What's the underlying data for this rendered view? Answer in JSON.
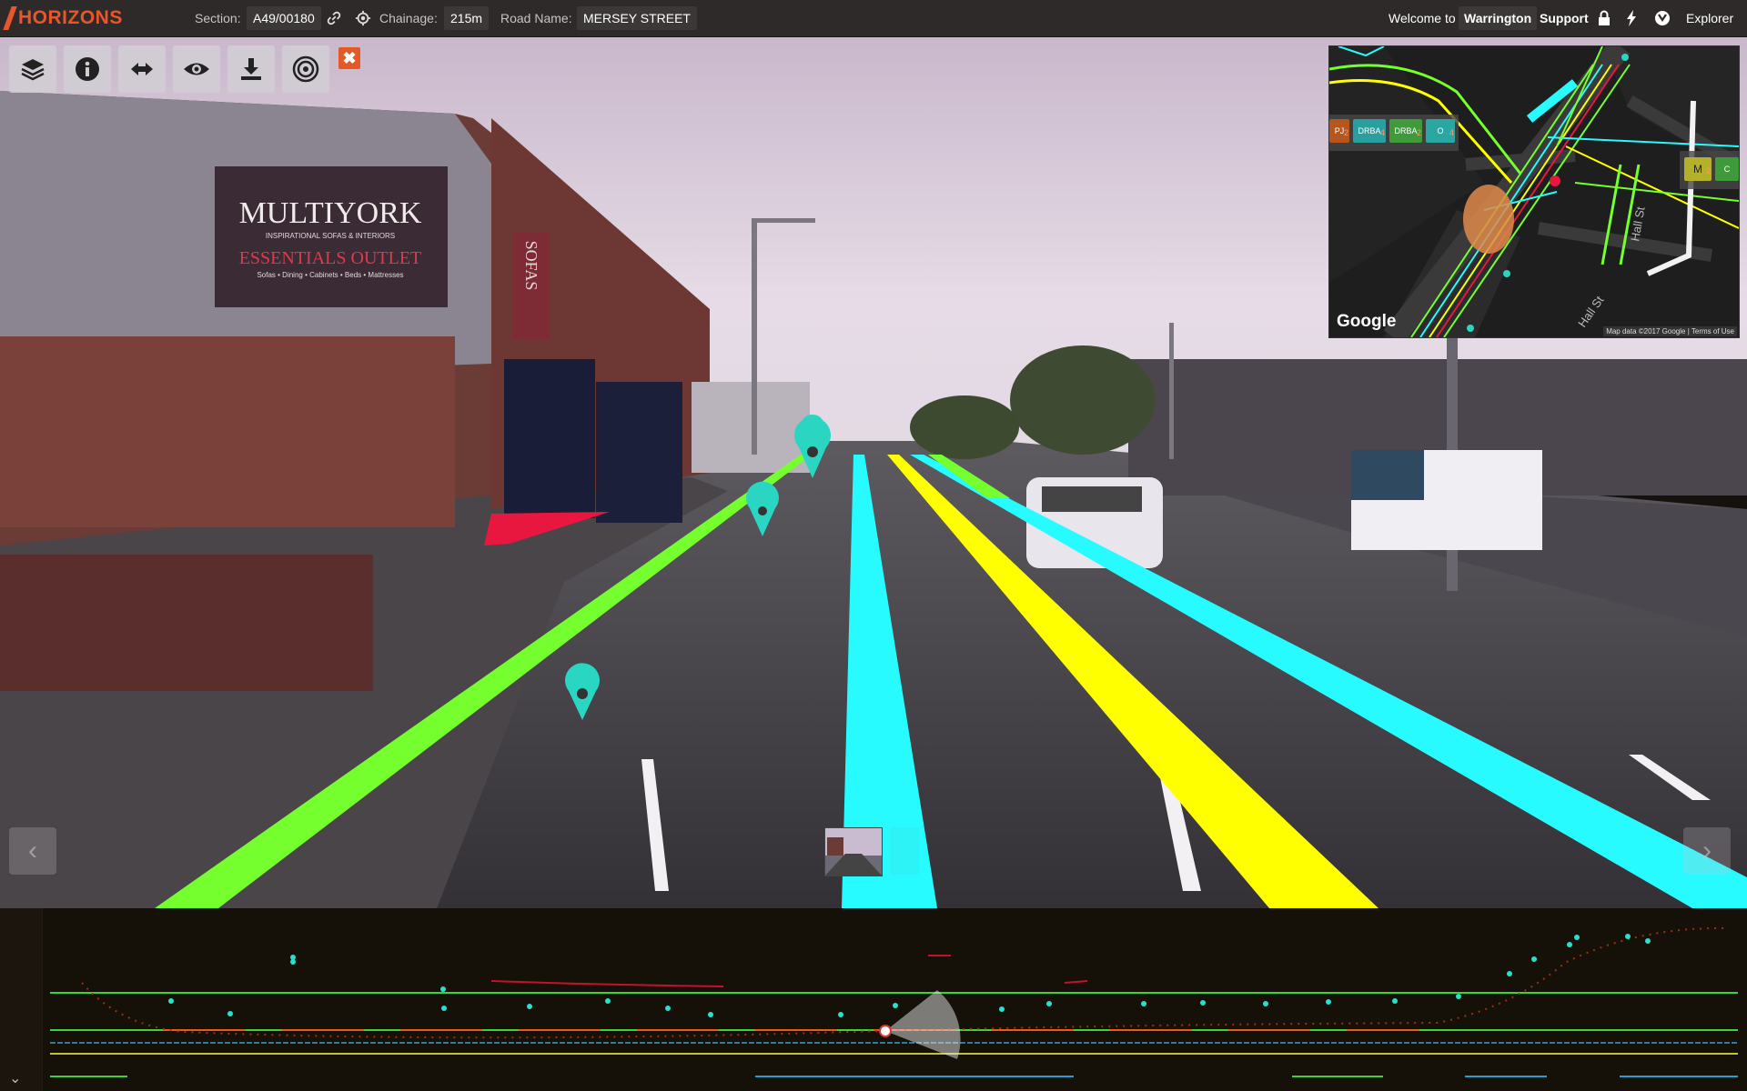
{
  "app": {
    "logo": "HORIZONS"
  },
  "header": {
    "section_label": "Section:",
    "section_value": "A49/00180",
    "chainage_label": "Chainage:",
    "chainage_value": "215m",
    "road_name_label": "Road Name:",
    "road_name_value": "MERSEY STREET",
    "welcome_label": "Welcome to",
    "welcome_value": "Warrington",
    "support_label": "Support",
    "explorer_label": "Explorer"
  },
  "toolbar": {
    "buttons": [
      {
        "name": "layers-button",
        "icon": "layers-icon"
      },
      {
        "name": "info-button",
        "icon": "info-icon"
      },
      {
        "name": "measure-button",
        "icon": "double-arrow-icon"
      },
      {
        "name": "visibility-button",
        "icon": "eye-icon"
      },
      {
        "name": "download-button",
        "icon": "download-icon"
      },
      {
        "name": "target-button",
        "icon": "target-icon"
      }
    ],
    "close_label": "✖"
  },
  "minimap": {
    "attribution": "Google",
    "map_data": "Map data ©2017 Google",
    "terms": "Terms of Use",
    "street_1": "Hall St",
    "street_2": "Hall St",
    "chips": [
      {
        "label": "PJ",
        "count": "2",
        "color": "#b5561f"
      },
      {
        "label": "DRBA",
        "count": "4",
        "color": "#2a9fa0"
      },
      {
        "label": "DRBA",
        "count": "2",
        "color": "#3e9a3a"
      },
      {
        "label": "O",
        "count": "4",
        "color": "#2aa6a3"
      },
      {
        "label": "M",
        "count": "2",
        "color": "#b4b02a"
      },
      {
        "label": "C",
        "count": "",
        "color": "#3e9a3a"
      }
    ]
  },
  "colors": {
    "accent": "#e8562b",
    "lane_green": "#76ff2e",
    "lane_cyan": "#27fbff",
    "lane_yellow": "#ffff00",
    "lane_red": "#e81740",
    "marker": "#2ad6c2"
  },
  "photo": {
    "shop_sign_title": "MULTIYORK",
    "shop_sign_tagline": "INSPIRATIONAL SOFAS & INTERIORS",
    "shop_sign_outlet": "ESSENTIALS OUTLET",
    "shop_sign_sub": "Sofas • Dining • Cabinets • Beds • Mattresses",
    "banner": "SOFAS"
  }
}
